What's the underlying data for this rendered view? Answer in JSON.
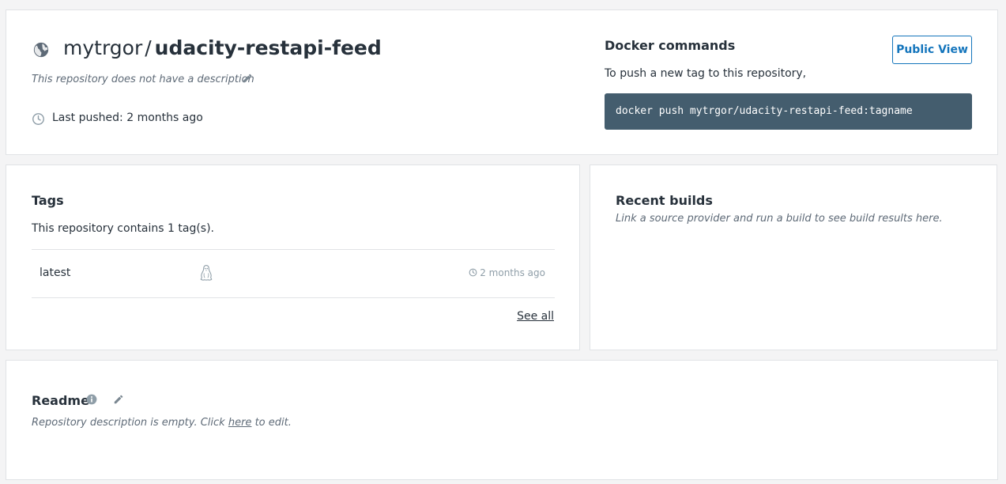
{
  "repo": {
    "namespace": "mytrgor",
    "separator": "/",
    "name": "udacity-restapi-feed",
    "description": "This repository does not have a description",
    "last_pushed": "Last pushed: 2 months ago"
  },
  "docker": {
    "title": "Docker commands",
    "subtitle": "To push a new tag to this repository,",
    "command": "docker push mytrgor/udacity-restapi-feed:tagname",
    "public_view_label": "Public View"
  },
  "tags": {
    "title": "Tags",
    "count_text": "This repository contains 1 tag(s).",
    "items": [
      {
        "name": "latest",
        "os_icon": "linux-icon",
        "time": "2 months ago"
      }
    ],
    "see_all_label": "See all"
  },
  "builds": {
    "title": "Recent builds",
    "subtitle": "Link a source provider and run a build to see build results here."
  },
  "readme": {
    "title": "Readme",
    "empty_prefix": "Repository description is empty. Click ",
    "link_label": "here",
    "empty_suffix": " to edit."
  },
  "colors": {
    "accent": "#1475bc",
    "command_bg": "#445d6e",
    "muted_text": "#5e6a77"
  }
}
